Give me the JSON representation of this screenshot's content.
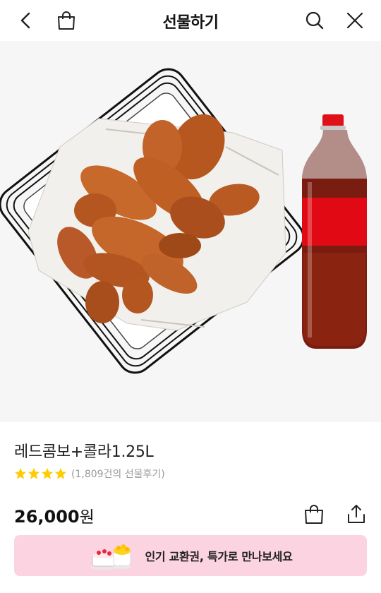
{
  "header": {
    "title": "선물하기",
    "icons": [
      "chevron-left-icon",
      "shopping-bag-icon",
      "search-icon",
      "close-icon"
    ]
  },
  "product": {
    "name": "레드콤보+콜라1.25L",
    "rating_stars": 4,
    "reviews": "(1,809건의 선물후기)",
    "price_value": "26,000",
    "price_unit": "원"
  },
  "promo": {
    "text": "인기 교환권, 특가로 만나보세요"
  },
  "colors": {
    "star": "#ffcc00",
    "promo_bg": "#fbd3e1",
    "cola_label": "#e10a14"
  }
}
